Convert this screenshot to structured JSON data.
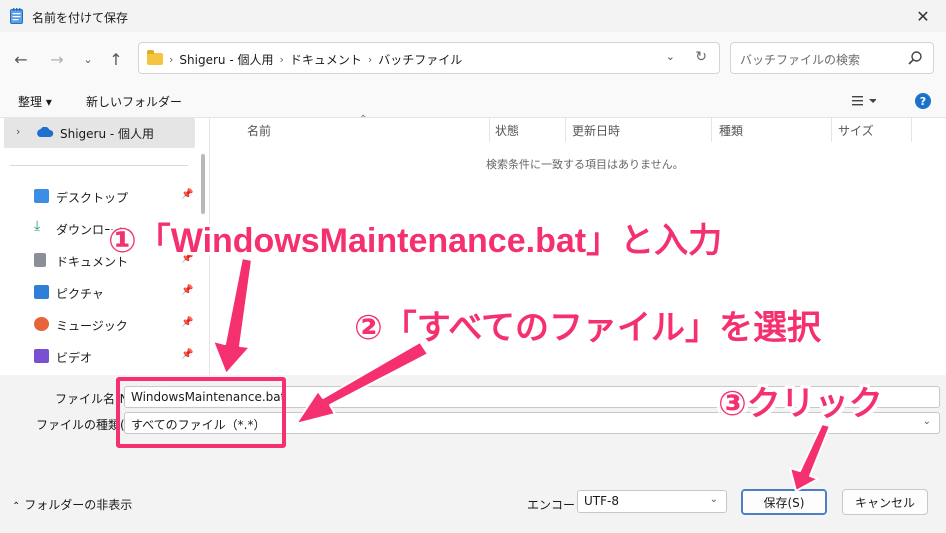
{
  "window": {
    "title": "名前を付けて保存"
  },
  "navigation": {
    "breadcrumbs": [
      "Shigeru - 個人用",
      "ドキュメント",
      "バッチファイル"
    ],
    "search_placeholder": "バッチファイルの検索"
  },
  "toolbar": {
    "organize": "整理 ▾",
    "new_folder": "新しいフォルダー"
  },
  "sidebar": {
    "top_item": "Shigeru - 個人用",
    "items": [
      {
        "label": "デスクトップ",
        "icon": "desktop-icon",
        "color": "#3a8ee6"
      },
      {
        "label": "ダウンロード",
        "icon": "download-icon",
        "color": "#1e9e5a"
      },
      {
        "label": "ドキュメント",
        "icon": "document-icon",
        "color": "#8a8f98"
      },
      {
        "label": "ピクチャ",
        "icon": "picture-icon",
        "color": "#2f7fd8"
      },
      {
        "label": "ミュージック",
        "icon": "music-icon",
        "color": "#e8623a"
      },
      {
        "label": "ビデオ",
        "icon": "video-icon",
        "color": "#7b4fd1"
      }
    ]
  },
  "file_list": {
    "columns": [
      "名前",
      "状態",
      "更新日時",
      "種類",
      "サイズ"
    ],
    "empty_message": "検索条件に一致する項目はありません。"
  },
  "form": {
    "filename_label": "ファイル名(N):",
    "filename_value": "WindowsMaintenance.bat",
    "filetype_label": "ファイルの種類(T):",
    "filetype_value": "すべてのファイル（*.*）",
    "encoding_label": "エンコード:",
    "encoding_value": "UTF-8",
    "save_button": "保存(S)",
    "cancel_button": "キャンセル",
    "hide_folders": "フォルダーの非表示"
  },
  "annotations": {
    "step1": "①「WindowsMaintenance.bat」と入力",
    "step2": "②「すべてのファイル」を選択",
    "step3": "③クリック"
  },
  "colors": {
    "accent": "#f5306e",
    "help": "#1a73c8"
  }
}
